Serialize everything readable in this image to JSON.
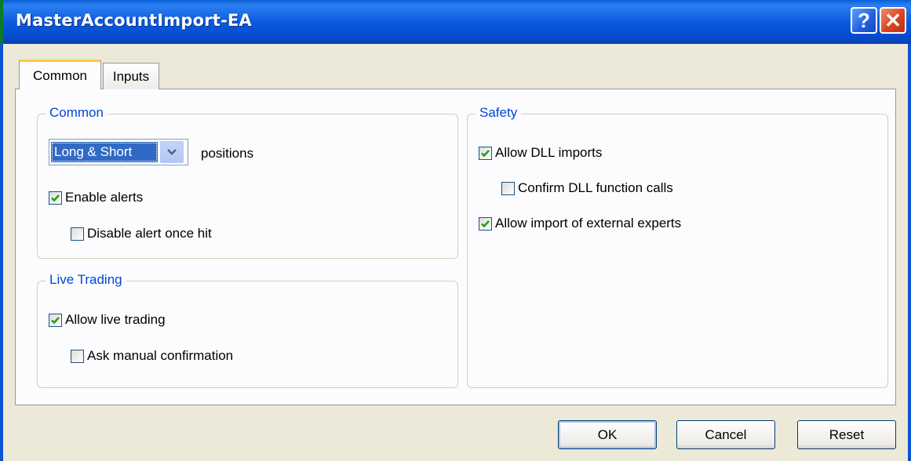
{
  "window": {
    "title": "MasterAccountImport-EA",
    "help_glyph": "?",
    "close_glyph": "✕"
  },
  "tabs": [
    {
      "label": "Common",
      "selected": true
    },
    {
      "label": "Inputs",
      "selected": false
    }
  ],
  "common_group": {
    "label": "Common",
    "positions_select": {
      "value": "Long & Short"
    },
    "positions_label": "positions",
    "enable_alerts": {
      "label": "Enable alerts",
      "checked": true
    },
    "disable_alert_once_hit": {
      "label": "Disable alert once hit",
      "checked": false
    }
  },
  "live_trading_group": {
    "label": "Live Trading",
    "allow_live_trading": {
      "label": "Allow live trading",
      "checked": true
    },
    "ask_manual_confirmation": {
      "label": "Ask manual confirmation",
      "checked": false
    }
  },
  "safety_group": {
    "label": "Safety",
    "allow_dll_imports": {
      "label": "Allow DLL imports",
      "checked": true
    },
    "confirm_dll_function_calls": {
      "label": "Confirm DLL function calls",
      "checked": false
    },
    "allow_import_external_experts": {
      "label": "Allow import of external experts",
      "checked": true
    }
  },
  "buttons": {
    "ok": "OK",
    "cancel": "Cancel",
    "reset": "Reset"
  },
  "colors": {
    "title_bar": "#0c5be0",
    "group_label": "#0046d5",
    "checkmark": "#21a121",
    "selection": "#316ac5"
  }
}
